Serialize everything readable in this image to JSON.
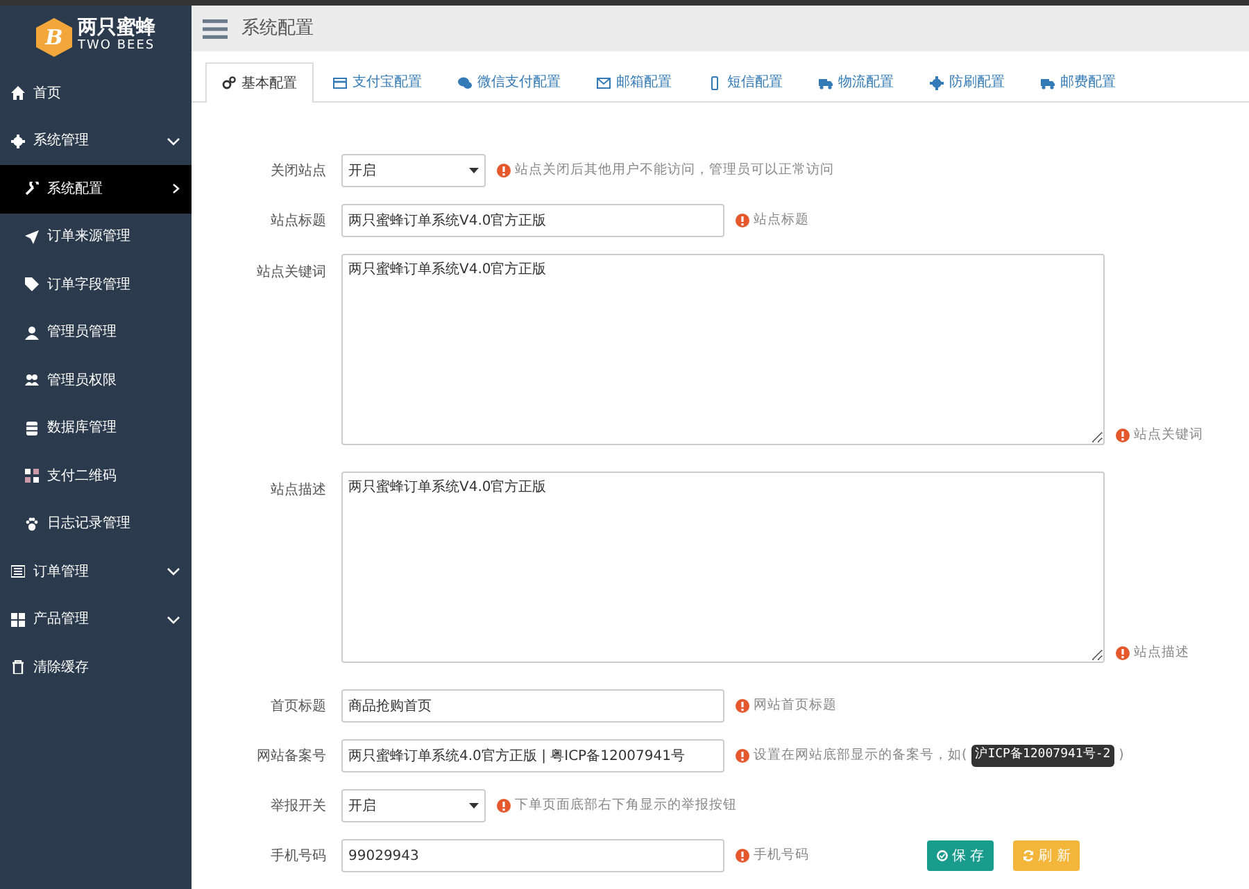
{
  "brand": {
    "name": "两只蜜蜂",
    "subtitle": "TWO BEES",
    "badge": "B"
  },
  "sidebar": {
    "items": [
      {
        "label": "首页",
        "selected": false
      },
      {
        "label": "系统管理",
        "selected": false,
        "children": [
          {
            "label": "系统配置",
            "selected": true
          },
          {
            "label": "订单来源管理",
            "selected": false
          },
          {
            "label": "订单字段管理",
            "selected": false
          },
          {
            "label": "管理员管理",
            "selected": false
          },
          {
            "label": "管理员权限",
            "selected": false
          },
          {
            "label": "数据库管理",
            "selected": false
          },
          {
            "label": "支付二维码",
            "selected": false
          },
          {
            "label": "日志记录管理",
            "selected": false
          }
        ]
      },
      {
        "label": "订单管理",
        "selected": false,
        "has_submenu": true
      },
      {
        "label": "产品管理",
        "selected": false,
        "has_submenu": true
      },
      {
        "label": "清除缓存",
        "selected": false
      }
    ]
  },
  "header": {
    "title": "系统配置"
  },
  "tabs": [
    {
      "label": "基本配置",
      "selected": true
    },
    {
      "label": "支付宝配置",
      "selected": false
    },
    {
      "label": "微信支付配置",
      "selected": false
    },
    {
      "label": "邮箱配置",
      "selected": false
    },
    {
      "label": "短信配置",
      "selected": false
    },
    {
      "label": "物流配置",
      "selected": false
    },
    {
      "label": "防刷配置",
      "selected": false
    },
    {
      "label": "邮费配置",
      "selected": false
    }
  ],
  "form": [
    {
      "kind": "select",
      "label": "关闭站点",
      "value": "开启",
      "hint": "站点关闭后其他用户不能访问，管理员可以正常访问"
    },
    {
      "kind": "input",
      "label": "站点标题",
      "value": "两只蜜蜂订单系统V4.0官方正版",
      "hint": "站点标题"
    },
    {
      "kind": "textarea",
      "label": "站点关键词",
      "value": "两只蜜蜂订单系统V4.0官方正版",
      "hint": "站点关键词"
    },
    {
      "kind": "textarea",
      "label": "站点描述",
      "value": "两只蜜蜂订单系统V4.0官方正版",
      "hint": "站点描述"
    },
    {
      "kind": "input",
      "label": "首页标题",
      "value": "商品抢购首页",
      "hint": "网站首页标题"
    },
    {
      "kind": "input",
      "label": "网站备案号",
      "value": "两只蜜蜂订单系统4.0官方正版 | 粤ICP备12007941号",
      "hint": "设置在网站底部显示的备案号，如(",
      "hint_code": "沪ICP备12007941号-2",
      "hint_suffix": ")"
    },
    {
      "kind": "select",
      "label": "举报开关",
      "value": "开启",
      "hint": "下单页面底部右下角显示的举报按钮"
    },
    {
      "kind": "input",
      "label": "手机号码",
      "value": "99029943",
      "hint": "手机号码"
    }
  ],
  "buttons": [
    {
      "kind": "save",
      "label": "保 存"
    },
    {
      "kind": "refresh",
      "label": "刷 新"
    }
  ]
}
